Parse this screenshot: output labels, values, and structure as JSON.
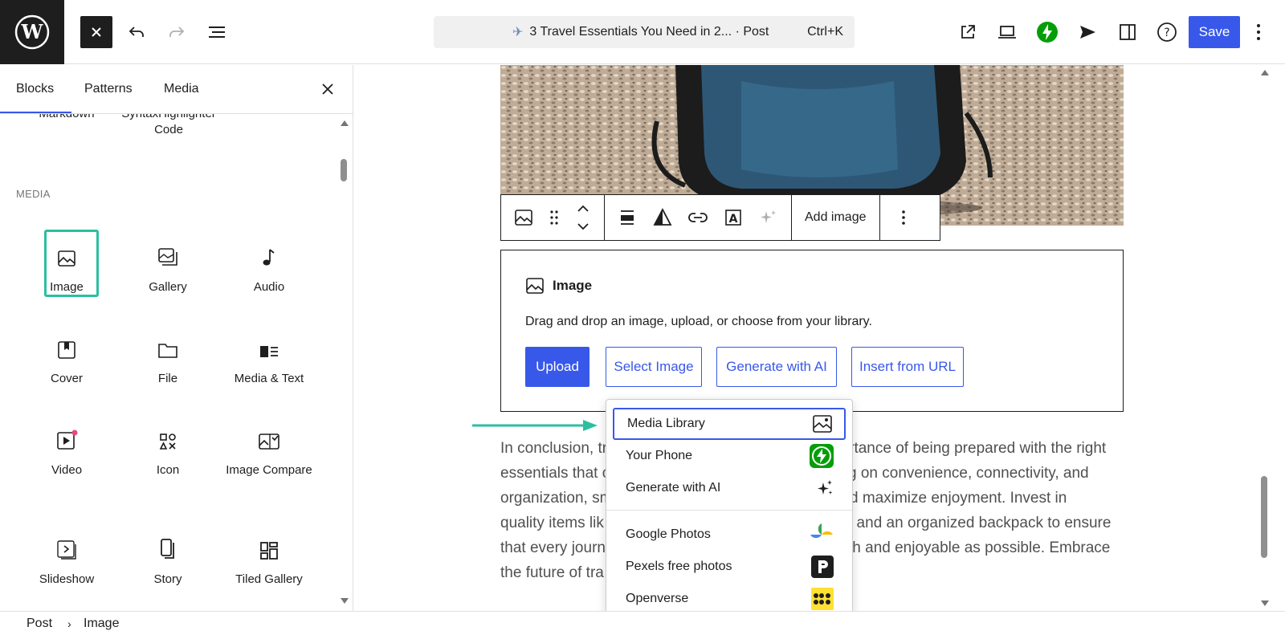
{
  "topbar": {
    "post_title": "3 Travel Essentials You Need in 2... · Post",
    "shortcut": "Ctrl+K",
    "save_label": "Save",
    "colors": {
      "accent": "#3858e9",
      "jetpack": "#069e08"
    }
  },
  "sidebar": {
    "tabs": [
      {
        "label": "Blocks"
      },
      {
        "label": "Patterns"
      },
      {
        "label": "Media"
      }
    ],
    "cut_items": [
      "Markdown",
      "SyntaxHighlighter Code"
    ],
    "section_label": "MEDIA",
    "blocks": [
      {
        "label": "Image",
        "icon": "image-icon"
      },
      {
        "label": "Gallery",
        "icon": "gallery-icon"
      },
      {
        "label": "Audio",
        "icon": "audio-icon"
      },
      {
        "label": "Cover",
        "icon": "cover-icon"
      },
      {
        "label": "File",
        "icon": "folder-icon"
      },
      {
        "label": "Media & Text",
        "icon": "media-text-icon"
      },
      {
        "label": "Video",
        "icon": "video-icon"
      },
      {
        "label": "Icon",
        "icon": "shapes-icon"
      },
      {
        "label": "Image Compare",
        "icon": "image-compare-icon"
      },
      {
        "label": "Slideshow",
        "icon": "slideshow-icon"
      },
      {
        "label": "Story",
        "icon": "story-icon"
      },
      {
        "label": "Tiled Gallery",
        "icon": "tiled-gallery-icon"
      }
    ]
  },
  "block_toolbar": {
    "add_image": "Add image"
  },
  "placeholder": {
    "title": "Image",
    "instructions": "Drag and drop an image, upload, or choose from your library.",
    "buttons": [
      "Upload",
      "Select Image",
      "Generate with AI",
      "Insert from URL"
    ]
  },
  "paragraph": {
    "lines": [
      "In conclusion, tr",
      "essentials that c",
      "organization, sm",
      "quality items lik",
      "that every journ",
      "the future of tra"
    ],
    "lines_right": [
      "portance of being prepared with the right",
      "g on convenience, connectivity, and",
      "d maximize enjoyment. Invest in",
      ", and an organized backpack to ensure",
      "th and enjoyable as possible. Embrace",
      ""
    ]
  },
  "dropdown": {
    "items": [
      {
        "label": "Media Library",
        "icon": "media-library-icon"
      },
      {
        "label": "Your Phone",
        "icon": "jetpack-icon"
      },
      {
        "label": "Generate with AI",
        "icon": "sparkles-icon"
      },
      {
        "label": "Google Photos",
        "icon": "google-photos-icon"
      },
      {
        "label": "Pexels free photos",
        "icon": "pexels-icon"
      },
      {
        "label": "Openverse",
        "icon": "openverse-icon"
      }
    ]
  },
  "breadcrumb": {
    "items": [
      "Post",
      "Image"
    ]
  }
}
